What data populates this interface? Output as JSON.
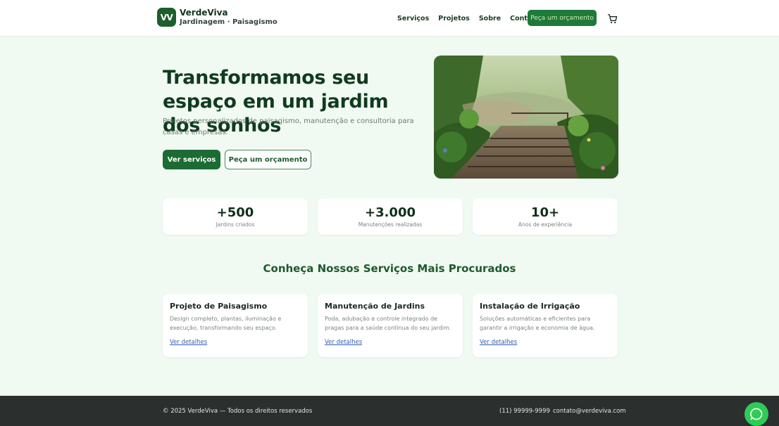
{
  "brand": {
    "badge": "VV",
    "name": "VerdeViva",
    "tagline": "Jardinagem · Paisagismo"
  },
  "nav": {
    "items": [
      "Serviços",
      "Projetos",
      "Sobre",
      "Contato"
    ],
    "cta": "Peça um orçamento",
    "cart_icon": "cart-icon"
  },
  "hero": {
    "title": "Transformamos seu espaço em um jardim dos sonhos",
    "subtitle": "Projetos personalizados de paisagismo, manutenção e consultoria para casas e empresas.",
    "primary_button": "Ver serviços",
    "secondary_button": "Peça um orçamento"
  },
  "stats": [
    {
      "value": "+500",
      "label": "Jardins criados"
    },
    {
      "value": "+3.000",
      "label": "Manutenções realizadas"
    },
    {
      "value": "10+",
      "label": "Anos de experiência"
    }
  ],
  "services": {
    "title": "Conheça Nossos Serviços Mais Procurados",
    "cards": [
      {
        "title": "Projeto de Paisagismo",
        "description": "Design completo, plantas, iluminação e execução, transformando seu espaço.",
        "link": "Ver detalhes"
      },
      {
        "title": "Manutenção de Jardins",
        "description": "Poda, adubação e controle integrado de pragas para a saúde contínua do seu jardim.",
        "link": "Ver detalhes"
      },
      {
        "title": "Instalação de Irrigação",
        "description": "Soluções automáticas e eficientes para garantir a irrigação e economia de água.",
        "link": "Ver detalhes"
      }
    ]
  },
  "footer": {
    "copyright": "© 2025 VerdeViva — Todos os direitos reservados",
    "phone": "(11) 99999-9999",
    "email": "contato@verdeviva.com"
  },
  "chat_icon": "chat-icon",
  "colors": {
    "primary": "#1c6b32",
    "background": "#f1faf2",
    "footer": "#2b2f2d",
    "chat": "#2ecc55"
  }
}
